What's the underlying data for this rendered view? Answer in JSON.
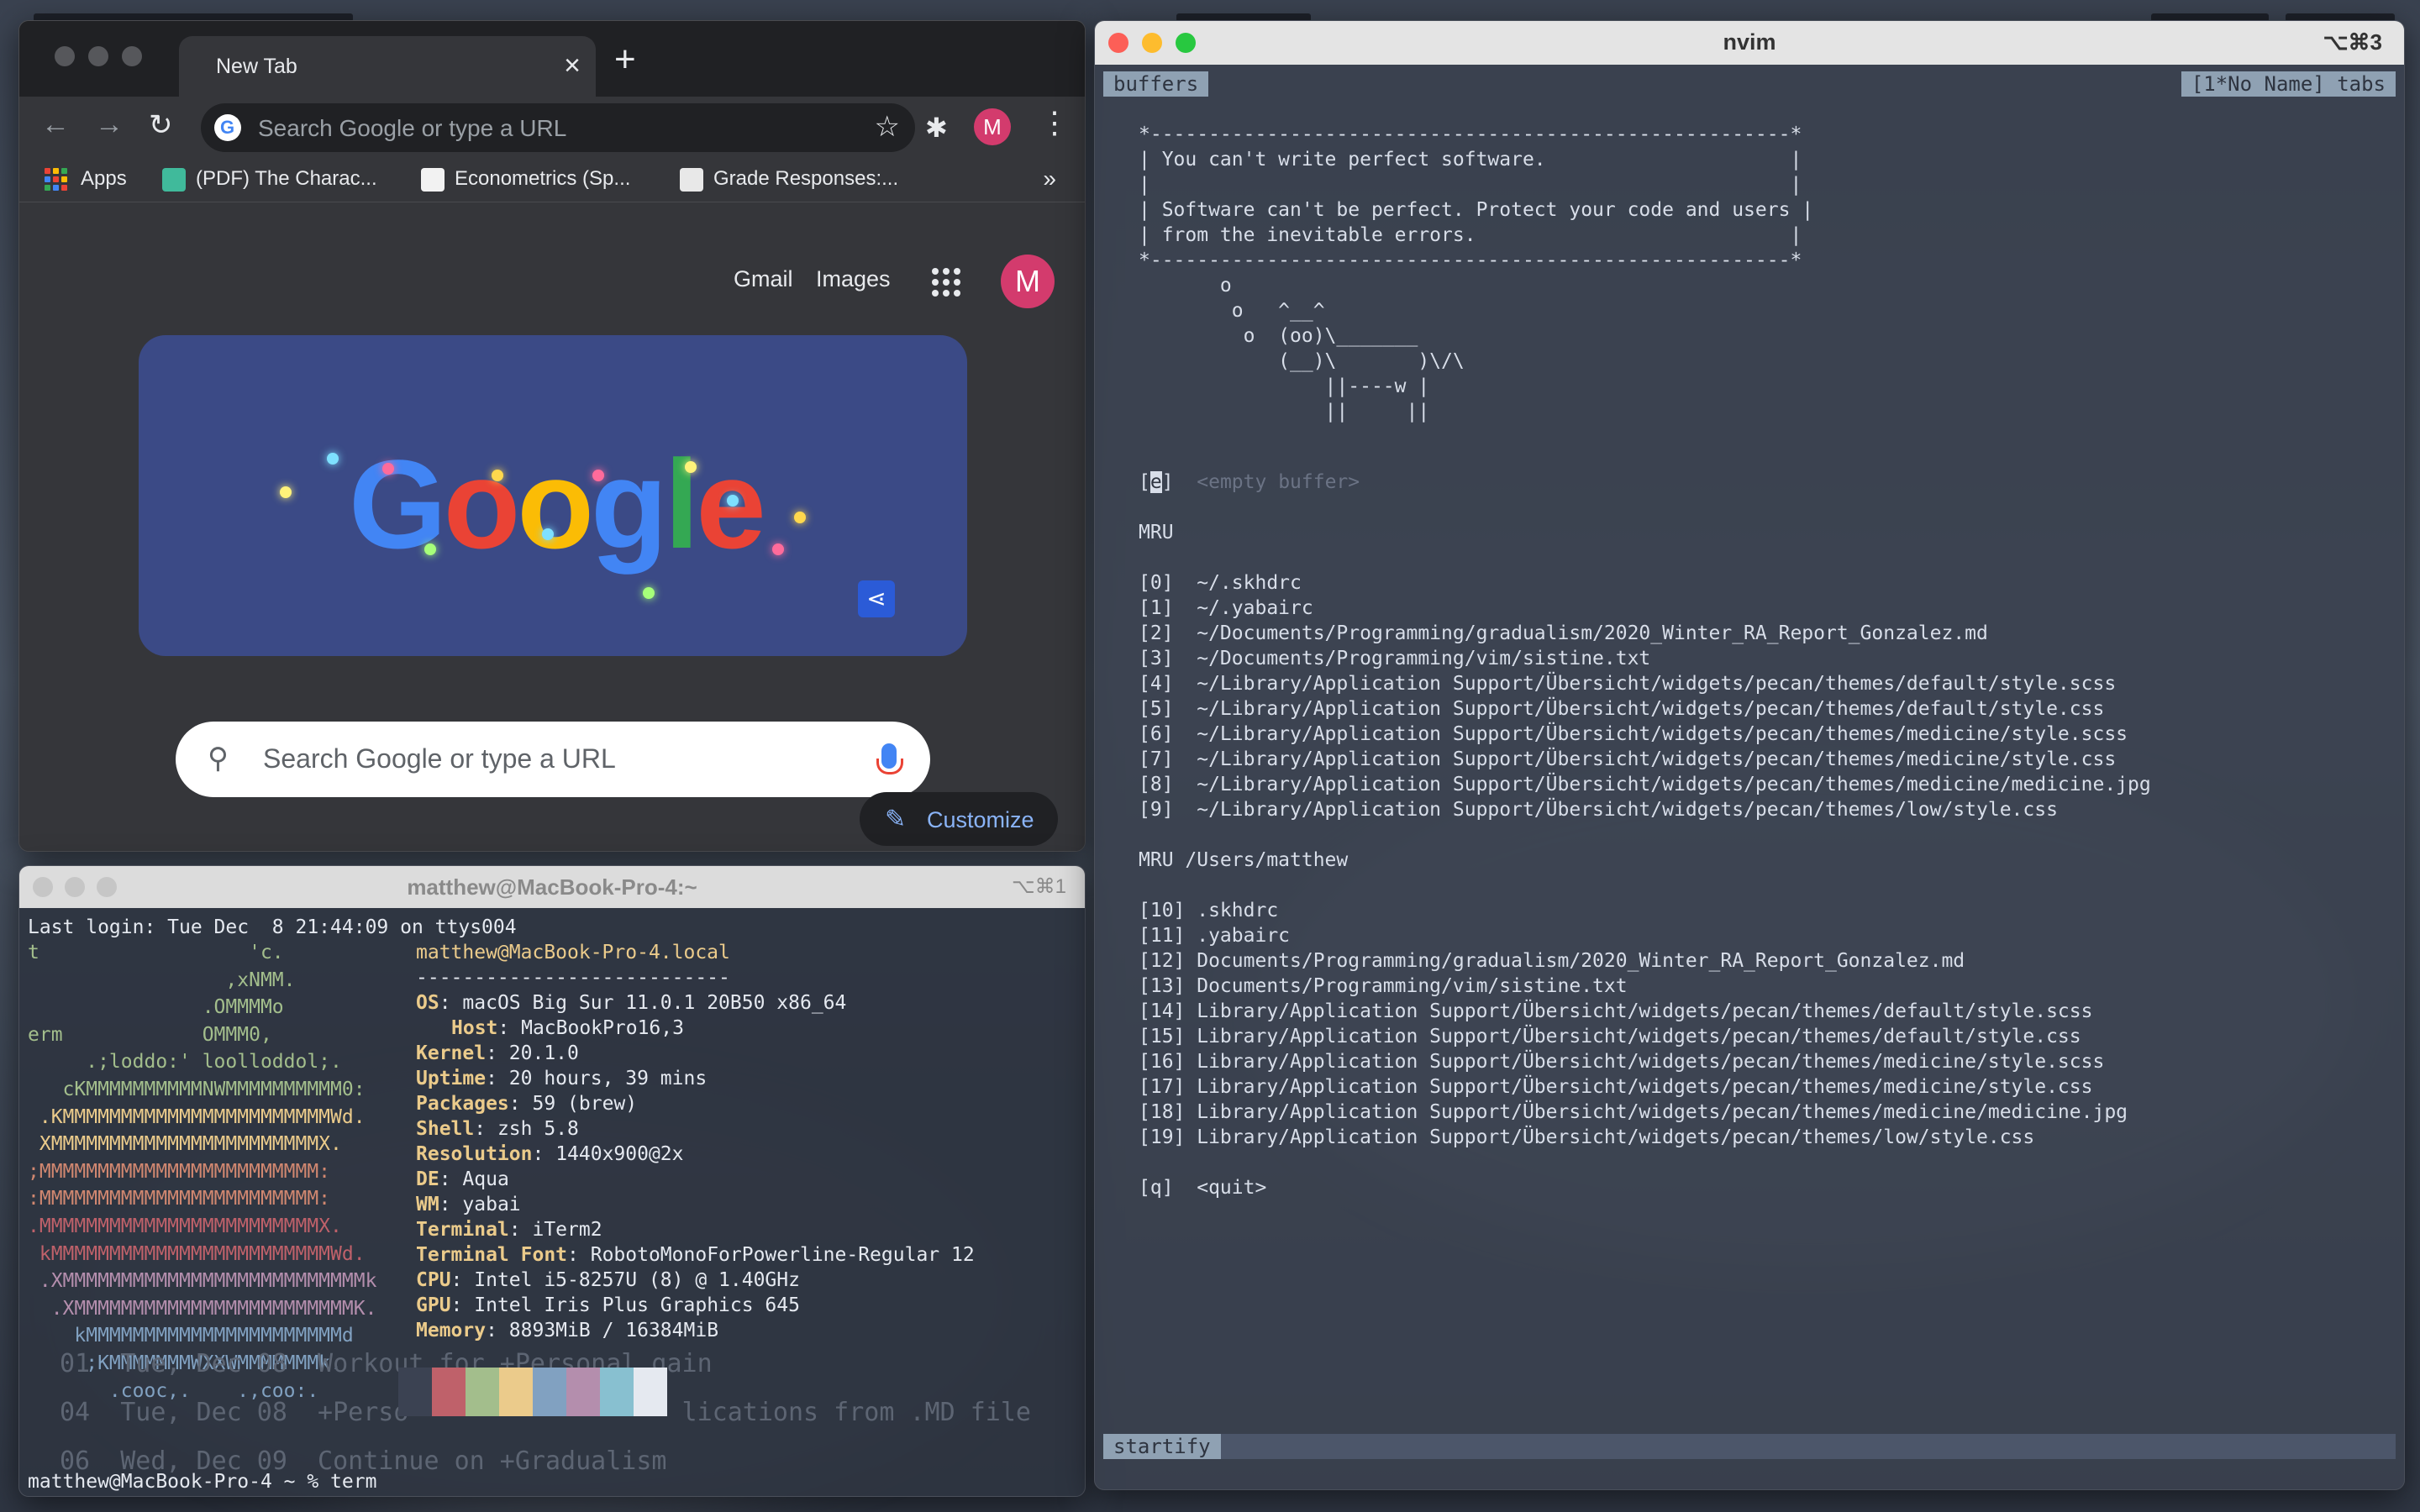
{
  "chrome": {
    "tab_title": "New Tab",
    "omnibox_placeholder": "Search Google or type a URL",
    "avatar_letter": "M",
    "bookmarks": [
      {
        "label": "Apps"
      },
      {
        "label": "(PDF) The Charac..."
      },
      {
        "label": "Econometrics (Sp..."
      },
      {
        "label": "Grade Responses:..."
      }
    ],
    "ntp": {
      "gmail": "Gmail",
      "images": "Images",
      "doodle_text": "Google",
      "search_placeholder": "Search Google or type a URL",
      "customize": "Customize"
    }
  },
  "terminal": {
    "title": "matthew@MacBook-Pro-4:~",
    "shortcut": "⌥⌘1",
    "last_login": "Last login: Tue Dec  8 21:44:09 on ttys004",
    "neofetch_art": [
      "t                  'c.",
      "                 ,xNMM.",
      "               .OMMMMo",
      "erm            OMMM0,",
      "     .;loddo:' loolloddol;.",
      "   cKMMMMMMMMMMNWMMMMMMMMMM0:",
      " .KMMMMMMMMMMMMMMMMMMMMMMMWd.",
      " XMMMMMMMMMMMMMMMMMMMMMMMX.",
      ";MMMMMMMMMMMMMMMMMMMMMMMM:",
      ":MMMMMMMMMMMMMMMMMMMMMMMM:",
      ".MMMMMMMMMMMMMMMMMMMMMMMMX.",
      " kMMMMMMMMMMMMMMMMMMMMMMMMWd.",
      " .XMMMMMMMMMMMMMMMMMMMMMMMMMMk",
      "  .XMMMMMMMMMMMMMMMMMMMMMMMMK.",
      "    kMMMMMMMMMMMMMMMMMMMMMMd",
      "     ;KMMMMMMMWXXWMMMMMMMk.",
      "       .cooc,.    .,coo:."
    ],
    "user_host": "matthew@MacBook-Pro-4.local",
    "separator": "---------------------------",
    "info": [
      {
        "key": "OS",
        "value": "macOS Big Sur 11.0.1 20B50 x86_64"
      },
      {
        "key": "Host",
        "value": "MacBookPro16,3"
      },
      {
        "key": "Kernel",
        "value": "20.1.0"
      },
      {
        "key": "Uptime",
        "value": "20 hours, 39 mins"
      },
      {
        "key": "Packages",
        "value": "59 (brew)"
      },
      {
        "key": "Shell",
        "value": "zsh 5.8"
      },
      {
        "key": "Resolution",
        "value": "1440x900@2x"
      },
      {
        "key": "DE",
        "value": "Aqua"
      },
      {
        "key": "WM",
        "value": "yabai"
      },
      {
        "key": "Terminal",
        "value": "iTerm2"
      },
      {
        "key": "Terminal Font",
        "value": "RobotoMonoForPowerline-Regular 12"
      },
      {
        "key": "CPU",
        "value": "Intel i5-8257U (8) @ 1.40GHz"
      },
      {
        "key": "GPU",
        "value": "Intel Iris Plus Graphics 645"
      },
      {
        "key": "Memory",
        "value": "8893MiB / 16384MiB"
      }
    ],
    "ghost_lines": [
      "01  Tue, Dec 08  Workout for +Personal gain",
      "04  Tue, Dec 08  +Perso                  lications from .MD file",
      "06  Wed, Dec 09  Continue on +Gradualism"
    ],
    "prompt": "matthew@MacBook-Pro-4 ~ % term",
    "swatch_colors": [
      "#3b4252",
      "#bf616a",
      "#a3be8c",
      "#ebcb8b",
      "#81a1c1",
      "#b48ead",
      "#88c0d0",
      "#e5e9f0"
    ]
  },
  "nvim": {
    "title": "nvim",
    "shortcut": "⌥⌘3",
    "tab_left": "buffers",
    "tab_right": "[1*No Name]  tabs",
    "cowsay": [
      "*-------------------------------------------------------*",
      "| You can't write perfect software.                     |",
      "|                                                       |",
      "| Software can't be perfect. Protect your code and users |",
      "| from the inevitable errors.                           |",
      "*-------------------------------------------------------*",
      "       o",
      "        o   ^__^",
      "         o  (oo)\\_______",
      "            (__)\\       )\\/\\",
      "                ||----w |",
      "                ||     ||"
    ],
    "empty_key": "e",
    "empty_label": "<empty buffer>",
    "mru_header": "MRU",
    "mru": [
      "[0]  ~/.skhdrc",
      "[1]  ~/.yabairc",
      "[2]  ~/Documents/Programming/gradualism/2020_Winter_RA_Report_Gonzalez.md",
      "[3]  ~/Documents/Programming/vim/sistine.txt",
      "[4]  ~/Library/Application Support/Übersicht/widgets/pecan/themes/default/style.scss",
      "[5]  ~/Library/Application Support/Übersicht/widgets/pecan/themes/default/style.css",
      "[6]  ~/Library/Application Support/Übersicht/widgets/pecan/themes/medicine/style.scss",
      "[7]  ~/Library/Application Support/Übersicht/widgets/pecan/themes/medicine/style.css",
      "[8]  ~/Library/Application Support/Übersicht/widgets/pecan/themes/medicine/medicine.jpg",
      "[9]  ~/Library/Application Support/Übersicht/widgets/pecan/themes/low/style.css"
    ],
    "mru_dir_header": "MRU /Users/matthew",
    "mru_dir": [
      "[10] .skhdrc",
      "[11] .yabairc",
      "[12] Documents/Programming/gradualism/2020_Winter_RA_Report_Gonzalez.md",
      "[13] Documents/Programming/vim/sistine.txt",
      "[14] Library/Application Support/Übersicht/widgets/pecan/themes/default/style.scss",
      "[15] Library/Application Support/Übersicht/widgets/pecan/themes/default/style.css",
      "[16] Library/Application Support/Übersicht/widgets/pecan/themes/medicine/style.scss",
      "[17] Library/Application Support/Übersicht/widgets/pecan/themes/medicine/style.css",
      "[18] Library/Application Support/Übersicht/widgets/pecan/themes/medicine/medicine.jpg",
      "[19] Library/Application Support/Übersicht/widgets/pecan/themes/low/style.css"
    ],
    "quit_line": "[q]  <quit>",
    "status_mode": "startify"
  }
}
